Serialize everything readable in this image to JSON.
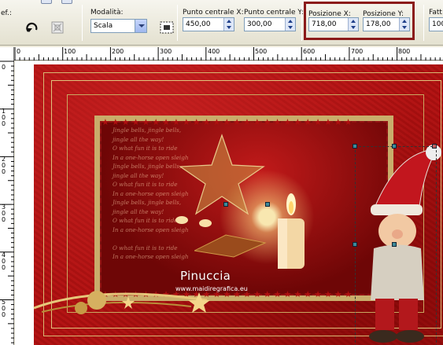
{
  "toolbar": {
    "partial_left_label": "ef.:",
    "mode_label": "Modalità:",
    "mode_value": "Scala",
    "center_x_label": "Punto centrale X:",
    "center_x_value": "450,00",
    "center_y_label": "Punto centrale Y:",
    "center_y_value": "300,00",
    "pos_x_label": "Posizione X:",
    "pos_x_value": "718,00",
    "pos_y_label": "Posizione Y:",
    "pos_y_value": "178,00",
    "factor_label": "Fatt",
    "factor_value": "100"
  },
  "ruler": {
    "h_ticks": [
      "0",
      "100",
      "200",
      "300",
      "400",
      "500",
      "600",
      "700",
      "800"
    ],
    "v_ticks": [
      "0",
      "100",
      "200",
      "300",
      "400",
      "500"
    ]
  },
  "artwork": {
    "lyrics": [
      "Jingle bells, jingle bells,",
      "jingle all the way!",
      "O what fun it is to ride",
      "In a one-horse open sleigh",
      "Jingle bells, jingle bells,",
      "jingle all the way!",
      "O what fun it is to ride",
      "In a one-horse open sleigh",
      "Jingle bells, jingle bells,",
      "jingle all the way!",
      "O what fun it is to ride",
      "In a one-horse open sleigh",
      "",
      "O what fun it is to ride",
      "In a one-horse open sleigh"
    ],
    "signature": "Pinuccia",
    "website": "www.maidiregrafica.eu"
  },
  "colors": {
    "accent_highlight": "#8b1a1a",
    "poster_red": "#b31414",
    "frame_gold": "#c9ad6b"
  }
}
